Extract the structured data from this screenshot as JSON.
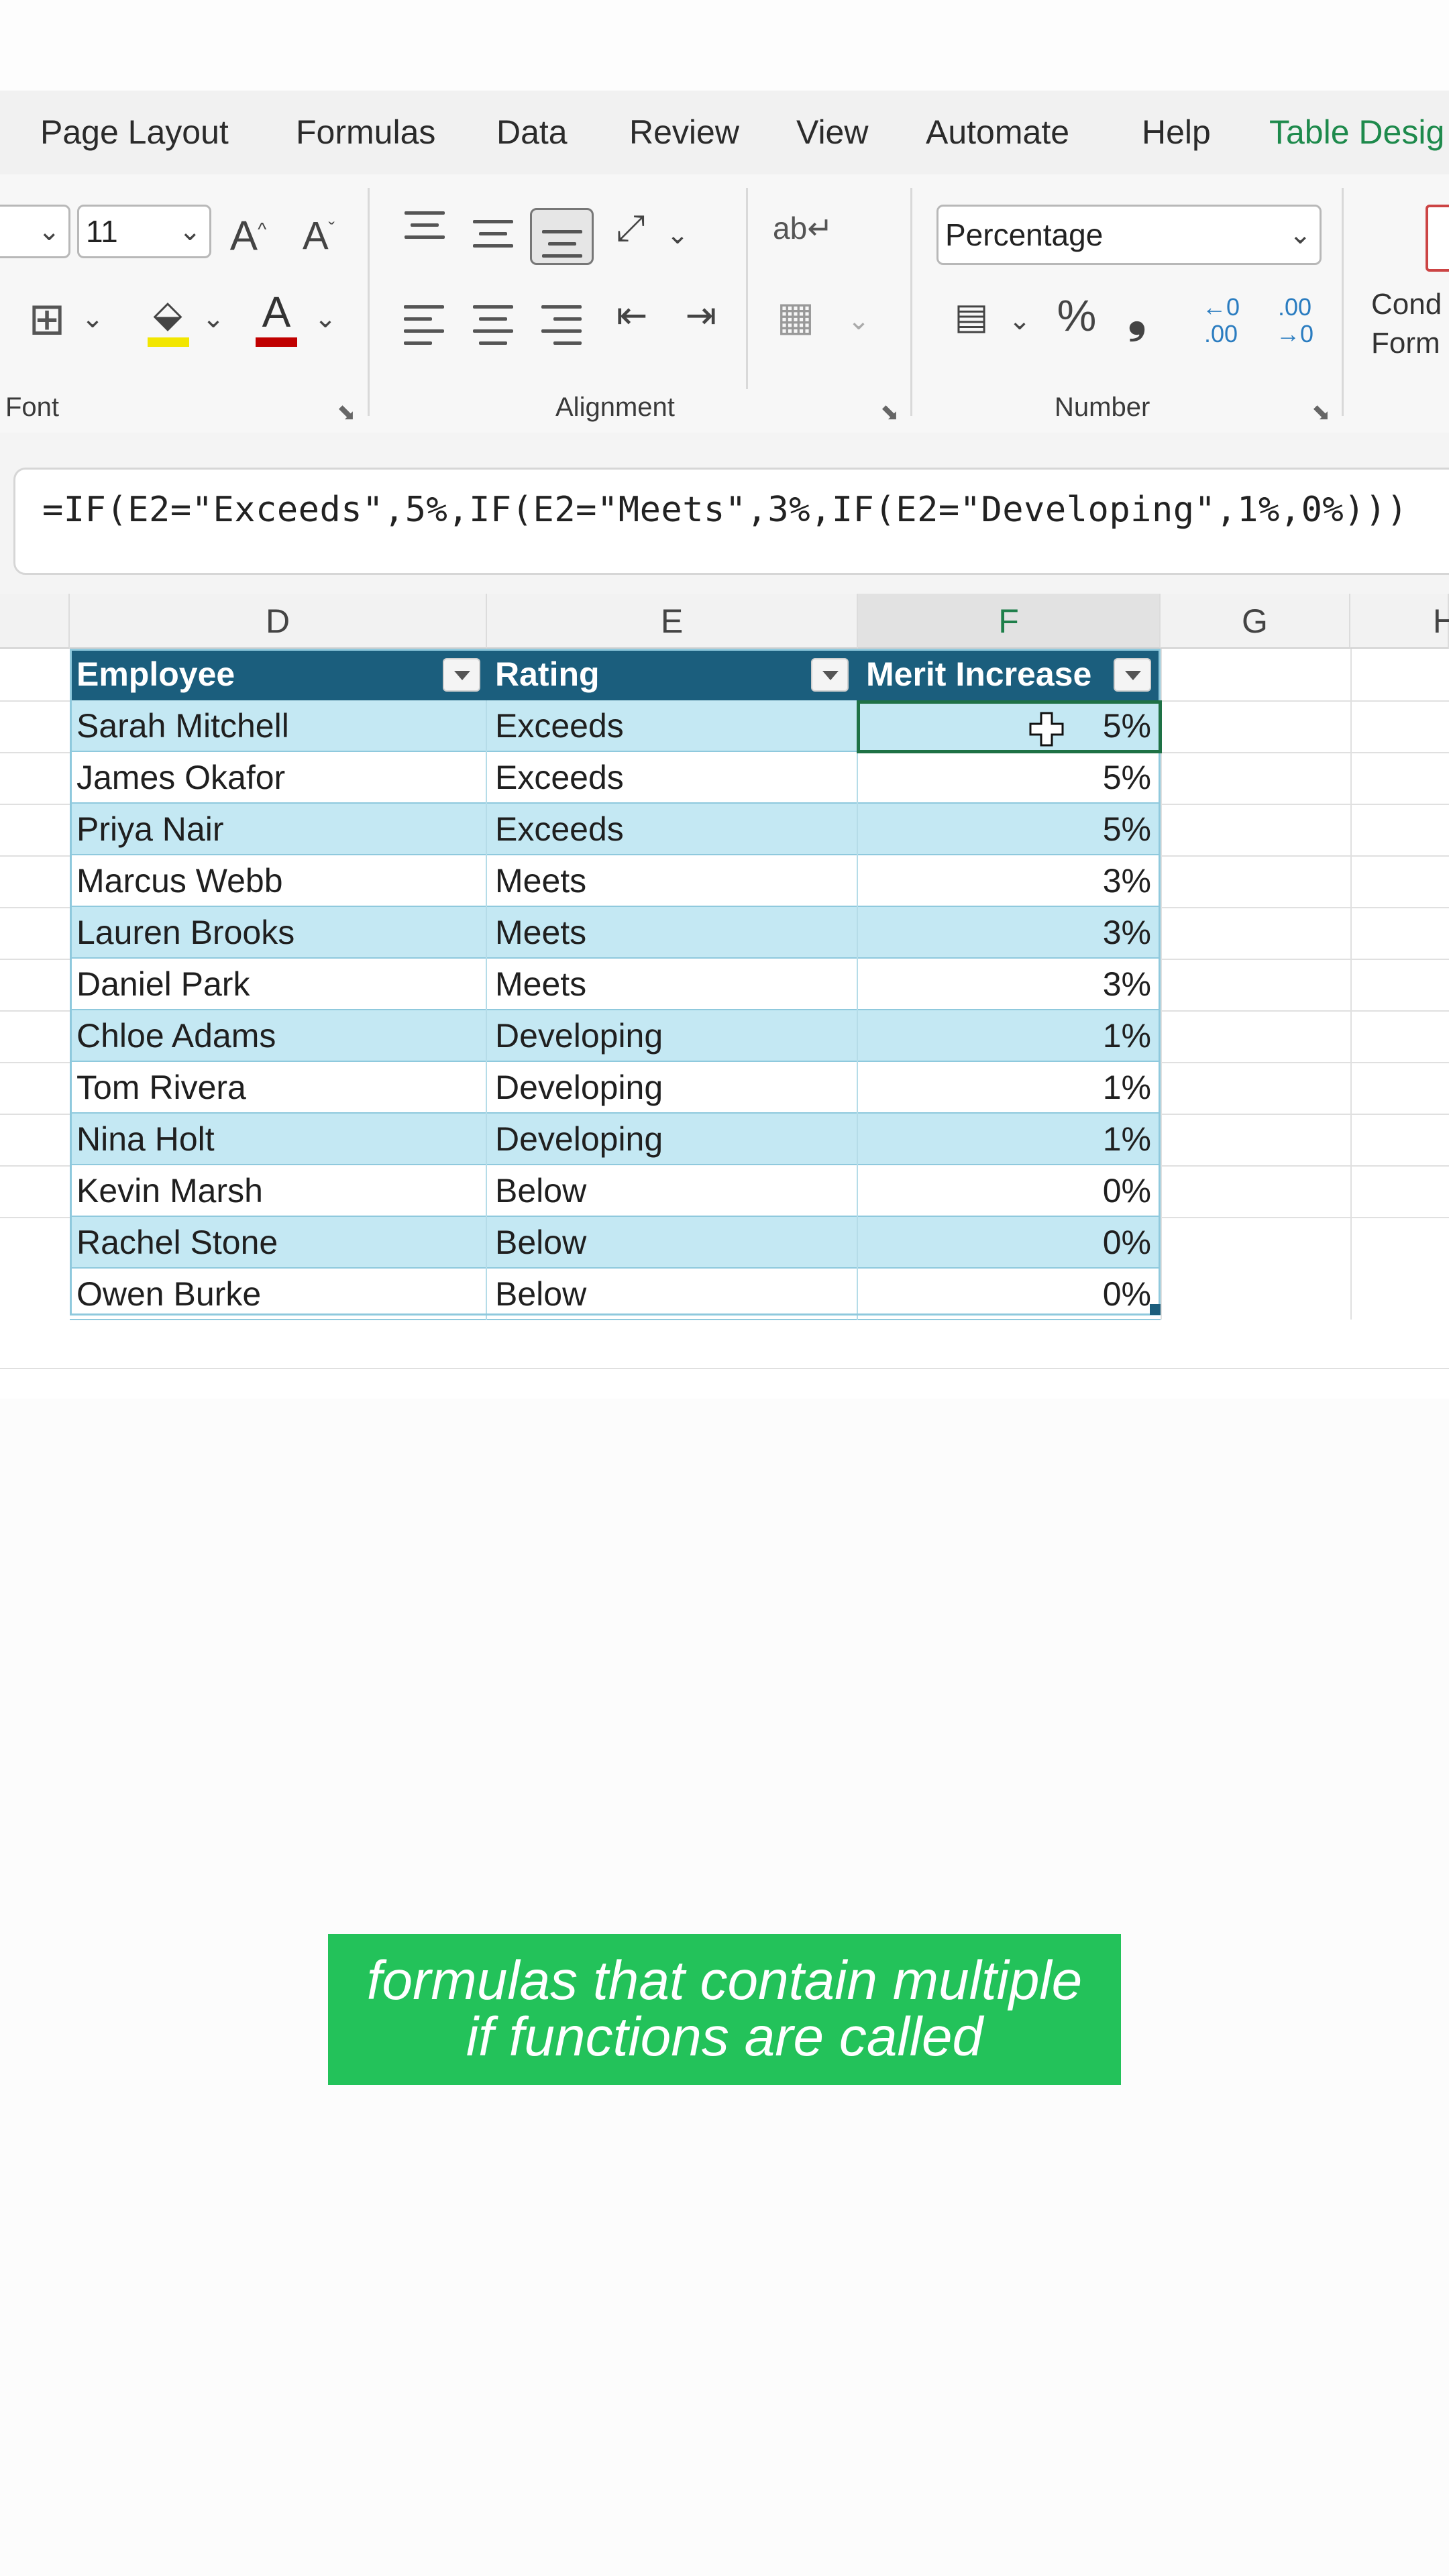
{
  "ribbon": {
    "tabs": [
      "Page Layout",
      "Formulas",
      "Data",
      "Review",
      "View",
      "Automate",
      "Help",
      "Table Desig"
    ],
    "font_size": "11",
    "font_group_label": "Font",
    "alignment_group_label": "Alignment",
    "number_group_label": "Number",
    "number_format": "Percentage",
    "percent_symbol": "%",
    "comma_symbol": "❟",
    "conditional_formatting_label": [
      "Cond",
      "Form"
    ]
  },
  "formula_bar": {
    "formula": "=IF(E2=\"Exceeds\",5%,IF(E2=\"Meets\",3%,IF(E2=\"Developing\",1%,0%)))"
  },
  "grid": {
    "column_headers": [
      "D",
      "E",
      "F",
      "G",
      "H"
    ],
    "selected_column": "F"
  },
  "table": {
    "headers": [
      "Employee",
      "Rating",
      "Merit Increase"
    ],
    "rows": [
      [
        "Sarah Mitchell",
        "Exceeds",
        "5%"
      ],
      [
        "James Okafor",
        "Exceeds",
        "5%"
      ],
      [
        "Priya Nair",
        "Exceeds",
        "5%"
      ],
      [
        "Marcus Webb",
        "Meets",
        "3%"
      ],
      [
        "Lauren Brooks",
        "Meets",
        "3%"
      ],
      [
        "Daniel Park",
        "Meets",
        "3%"
      ],
      [
        "Chloe Adams",
        "Developing",
        "1%"
      ],
      [
        "Tom Rivera",
        "Developing",
        "1%"
      ],
      [
        "Nina Holt",
        "Developing",
        "1%"
      ],
      [
        "Kevin Marsh",
        "Below",
        "0%"
      ],
      [
        "Rachel Stone",
        "Below",
        "0%"
      ],
      [
        "Owen Burke",
        "Below",
        "0%"
      ]
    ],
    "header_color": "#1b5e7d",
    "band_color": "#c4e8f3"
  },
  "caption": {
    "line1": "formulas that contain multiple",
    "line2": "if functions are called",
    "background": "#23c25a"
  },
  "colors": {
    "accent_green": "#1e8a4c",
    "font_color_red": "#c00000",
    "highlight_yellow": "#f2e600"
  }
}
